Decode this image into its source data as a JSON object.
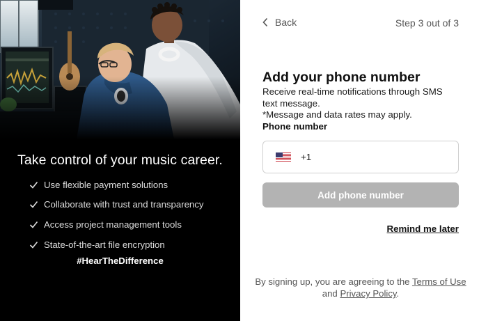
{
  "promo": {
    "headline": "Take control of your music career.",
    "features": [
      "Use flexible payment solutions",
      "Collaborate with trust and transparency",
      "Access project management tools",
      "State-of-the-art file encryption"
    ],
    "hashtag": "#HearTheDifference"
  },
  "nav": {
    "back_label": "Back",
    "step_text": "Step 3 out of 3"
  },
  "form": {
    "title": "Add your phone number",
    "description_1": "Receive real-time notifications through SMS text message.",
    "description_2": "*Message and data rates may apply.",
    "field_label": "Phone number",
    "country_flag": "us-flag-icon",
    "dial_code": "+1",
    "phone_value": "",
    "submit_label": "Add phone number",
    "remind_label": "Remind me later"
  },
  "legal": {
    "prefix": "By signing up, you are agreeing to the ",
    "terms_label": "Terms of Use",
    "middle": " and ",
    "privacy_label": "Privacy Policy",
    "suffix": "."
  },
  "colors": {
    "left_background": "#000000",
    "button_disabled": "#b3b3b3",
    "text_dark": "#111111",
    "text_muted": "#555555"
  }
}
